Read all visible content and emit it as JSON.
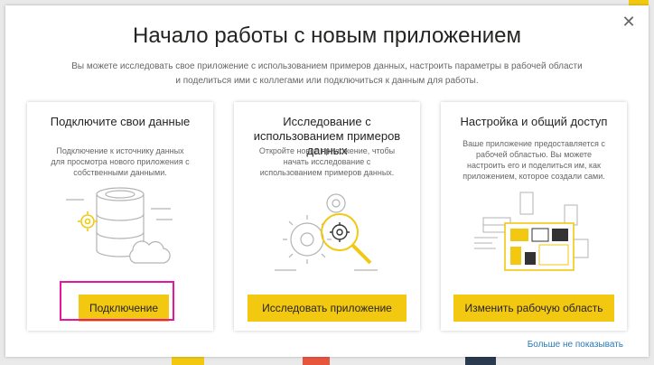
{
  "dialog": {
    "title": "Начало работы с новым приложением",
    "subtitle": "Вы можете исследовать свое приложение с использованием примеров данных, настроить параметры в рабочей области и поделиться ими с коллегами или подключиться к данным для работы.",
    "close_icon": "close-icon",
    "dont_show_label": "Больше не показывать"
  },
  "cards": [
    {
      "title": "Подключите свои данные",
      "description": "Подключение к источнику данных для просмотра нового приложения с собственными данными.",
      "button_label": "Подключение",
      "illustration_icon": "database-cloud-icon"
    },
    {
      "title": "Исследование с использованием примеров данных",
      "description": "Откройте новое приложение, чтобы начать исследование с использованием примеров данных.",
      "button_label": "Исследовать приложение",
      "illustration_icon": "gears-magnifier-icon"
    },
    {
      "title": "Настройка и общий доступ",
      "description": "Ваше приложение предоставляется с рабочей областью. Вы можете настроить его и поделиться им, как приложением, которое создали сами.",
      "button_label": "Изменить рабочую область",
      "illustration_icon": "dashboard-reports-icon"
    }
  ],
  "colors": {
    "accent": "#f2c811",
    "highlight": "#e5179e",
    "link": "#2a7ab6",
    "text": "#252423",
    "muted": "#666666"
  }
}
